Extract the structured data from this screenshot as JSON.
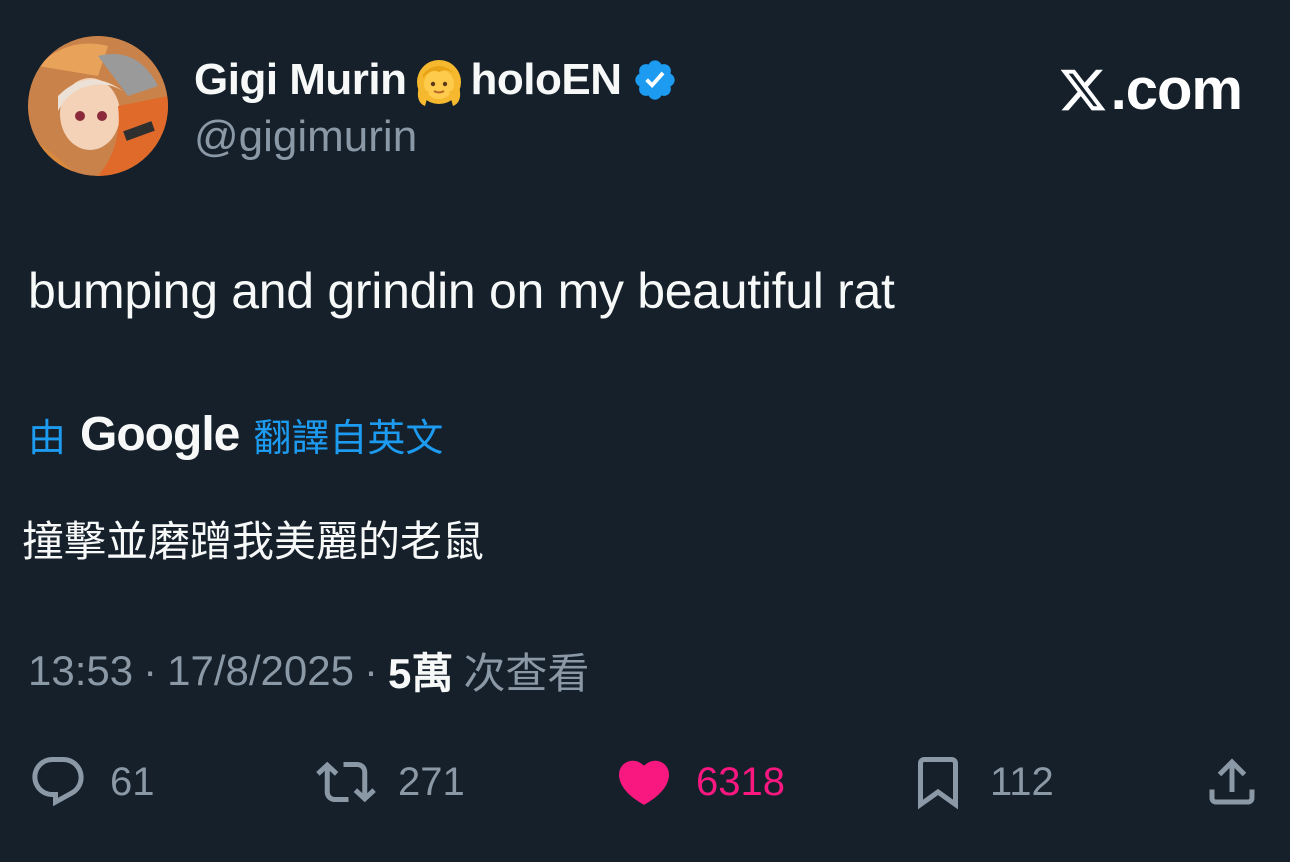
{
  "author": {
    "display_name": "Gigi Murin",
    "name_suffix": "holoEN",
    "name_emoji": "person-with-blond-hair-emoji",
    "verified": true,
    "handle": "@gigimurin"
  },
  "brand": {
    "logo_text": ".com",
    "logo_icon": "x-logo-icon"
  },
  "tweet": {
    "text": "bumping and grindin on my beautiful rat"
  },
  "translation": {
    "prefix": "由",
    "provider": "Google",
    "suffix": "翻譯自英文",
    "text": "撞擊並磨蹭我美麗的老鼠"
  },
  "meta": {
    "time": "13:53",
    "separator": "·",
    "date": "17/8/2025",
    "views_count": "5萬",
    "views_label": "次查看"
  },
  "actions": {
    "replies": "61",
    "reposts": "271",
    "likes": "6318",
    "bookmarks": "112"
  },
  "colors": {
    "background": "#15202b",
    "accent": "#1d9bf0",
    "like": "#f91880",
    "muted": "#8b98a5",
    "verified": "#1d9bf0"
  }
}
